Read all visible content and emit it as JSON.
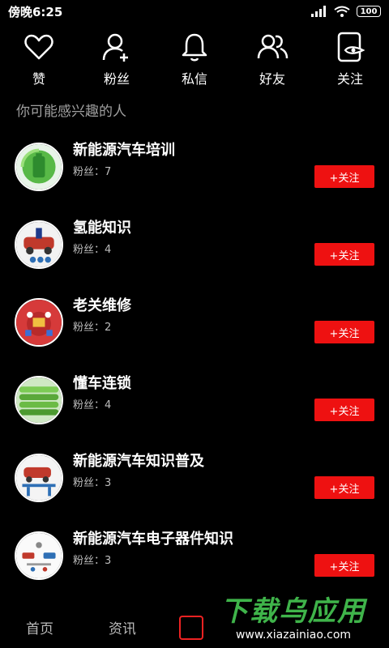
{
  "status_bar": {
    "time": "傍晚6:25",
    "battery": "100"
  },
  "top_actions": [
    {
      "label": "赞",
      "icon": "heart-icon"
    },
    {
      "label": "粉丝",
      "icon": "add-person-icon"
    },
    {
      "label": "私信",
      "icon": "bell-icon"
    },
    {
      "label": "好友",
      "icon": "two-people-icon"
    },
    {
      "label": "关注",
      "icon": "eye-phone-icon"
    }
  ],
  "section_title": "你可能感兴趣的人",
  "items": [
    {
      "name": "新能源汽车培训",
      "fans": "粉丝：7",
      "button": "+关注"
    },
    {
      "name": "氢能知识",
      "fans": "粉丝：4",
      "button": "+关注"
    },
    {
      "name": "老关维修",
      "fans": "粉丝：2",
      "button": "+关注"
    },
    {
      "name": "懂车连锁",
      "fans": "粉丝：4",
      "button": "+关注"
    },
    {
      "name": "新能源汽车知识普及",
      "fans": "粉丝：3",
      "button": "+关注"
    },
    {
      "name": "新能源汽车电子器件知识",
      "fans": "粉丝：3",
      "button": "+关注"
    }
  ],
  "bottom_nav": {
    "home": "首页",
    "news": "资讯"
  },
  "watermark": {
    "title": "下载乌应用",
    "url": "www.xiazainiao.com"
  },
  "colors": {
    "accent": "#ee1111",
    "watermark_green": "#3fb44a"
  }
}
